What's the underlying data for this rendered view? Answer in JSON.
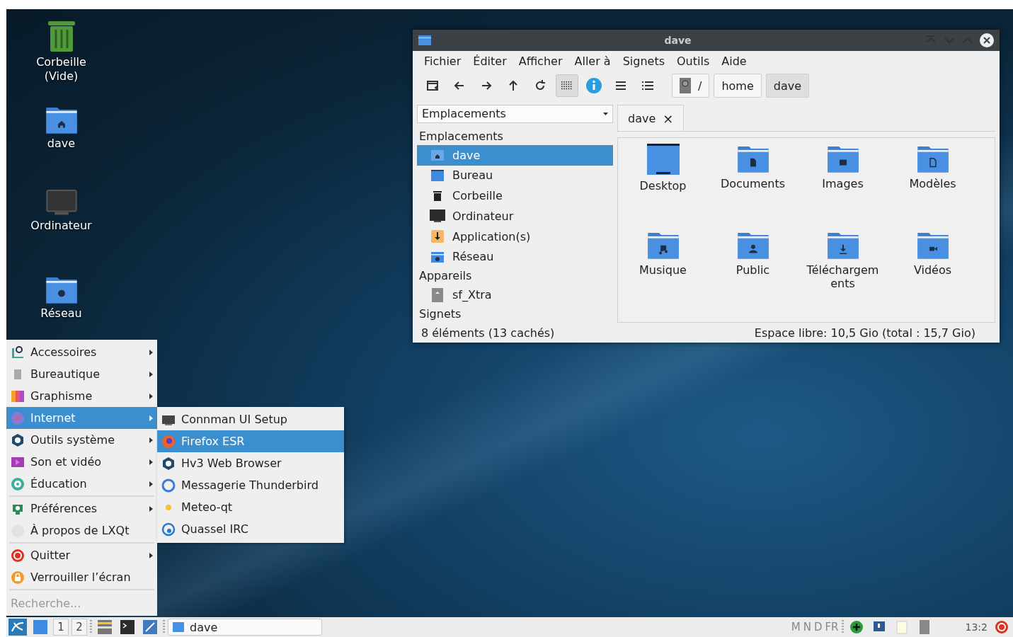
{
  "desktop_icons": [
    {
      "kind": "trash",
      "label": "Corbeille (Vide)"
    },
    {
      "kind": "home",
      "label": "dave"
    },
    {
      "kind": "computer",
      "label": "Ordinateur"
    },
    {
      "kind": "network",
      "label": "Réseau"
    }
  ],
  "window": {
    "title": "dave",
    "menu": [
      "Fichier",
      "Éditer",
      "Afficher",
      "Aller à",
      "Signets",
      "Outils",
      "Aide"
    ],
    "view_buttons": [
      {
        "kind": "icons",
        "selected": true
      },
      {
        "kind": "info",
        "selected": false
      },
      {
        "kind": "compact",
        "selected": false
      },
      {
        "kind": "details",
        "selected": false
      }
    ],
    "path": [
      {
        "label": "/",
        "selected": false
      },
      {
        "label": "home",
        "selected": false
      },
      {
        "label": "dave",
        "selected": true
      }
    ],
    "places_dropdown": "Emplacements",
    "sidebar": [
      {
        "kind": "heading",
        "label": "Emplacements"
      },
      {
        "kind": "home",
        "label": "dave",
        "selected": true
      },
      {
        "kind": "desktop",
        "label": "Bureau",
        "selected": false
      },
      {
        "kind": "trash",
        "label": "Corbeille",
        "selected": false
      },
      {
        "kind": "computer",
        "label": "Ordinateur",
        "selected": false
      },
      {
        "kind": "apps",
        "label": "Application(s)",
        "selected": false
      },
      {
        "kind": "network",
        "label": "Réseau",
        "selected": false
      },
      {
        "kind": "heading",
        "label": "Appareils"
      },
      {
        "kind": "drive",
        "label": "sf_Xtra",
        "selected": false
      },
      {
        "kind": "heading",
        "label": "Signets"
      }
    ],
    "tabs": [
      {
        "label": "dave",
        "close": "×",
        "selected": true
      }
    ],
    "files": [
      {
        "kind": "desktop",
        "label": "Desktop"
      },
      {
        "kind": "document",
        "label": "Documents"
      },
      {
        "kind": "image",
        "label": "Images"
      },
      {
        "kind": "template",
        "label": "Modèles"
      },
      {
        "kind": "music",
        "label": "Musique"
      },
      {
        "kind": "user",
        "label": "Public"
      },
      {
        "kind": "download",
        "label": "Téléchargem ents"
      },
      {
        "kind": "video",
        "label": "Vidéos"
      }
    ],
    "status_left": "8 éléments (13 cachés)",
    "status_right": "Espace libre: 10,5 Gio (total : 15,7 Gio)"
  },
  "start_menu": {
    "items": [
      {
        "kind": "accessories",
        "label": "Accessoires",
        "submenu": true,
        "selected": false
      },
      {
        "kind": "office",
        "label": "Bureautique",
        "submenu": true,
        "selected": false
      },
      {
        "kind": "graphics",
        "label": "Graphisme",
        "submenu": true,
        "selected": false
      },
      {
        "kind": "internet",
        "label": "Internet",
        "submenu": true,
        "selected": true
      },
      {
        "kind": "system",
        "label": "Outils système",
        "submenu": true,
        "selected": false
      },
      {
        "kind": "media",
        "label": "Son et vidéo",
        "submenu": true,
        "selected": false
      },
      {
        "kind": "education",
        "label": "Éducation",
        "submenu": true,
        "selected": false
      },
      {
        "kind": "separator"
      },
      {
        "kind": "preferences",
        "label": "Préférences",
        "submenu": true,
        "selected": false
      },
      {
        "kind": "about",
        "label": "À propos de LXQt",
        "submenu": false,
        "selected": false
      },
      {
        "kind": "separator"
      },
      {
        "kind": "quit",
        "label": "Quitter",
        "submenu": true,
        "selected": false
      },
      {
        "kind": "lock",
        "label": "Verrouiller l’écran",
        "submenu": false,
        "selected": false
      },
      {
        "kind": "separator"
      }
    ],
    "search_placeholder": "Recherche..."
  },
  "submenu": [
    {
      "kind": "connman",
      "label": "Connman UI Setup",
      "selected": false
    },
    {
      "kind": "firefox",
      "label": "Firefox ESR",
      "selected": true
    },
    {
      "kind": "system",
      "label": "Hv3 Web Browser",
      "selected": false
    },
    {
      "kind": "thunderbird",
      "label": "Messagerie Thunderbird",
      "selected": false
    },
    {
      "kind": "weather",
      "label": "Meteo-qt",
      "selected": false
    },
    {
      "kind": "quassel",
      "label": "Quassel IRC",
      "selected": false
    }
  ],
  "taskbar": {
    "desktops": [
      "1",
      "2"
    ],
    "tasks": [
      {
        "label": "dave"
      }
    ],
    "keyboard": [
      "M",
      "N",
      "D",
      "FR"
    ],
    "clock": "13:2"
  }
}
